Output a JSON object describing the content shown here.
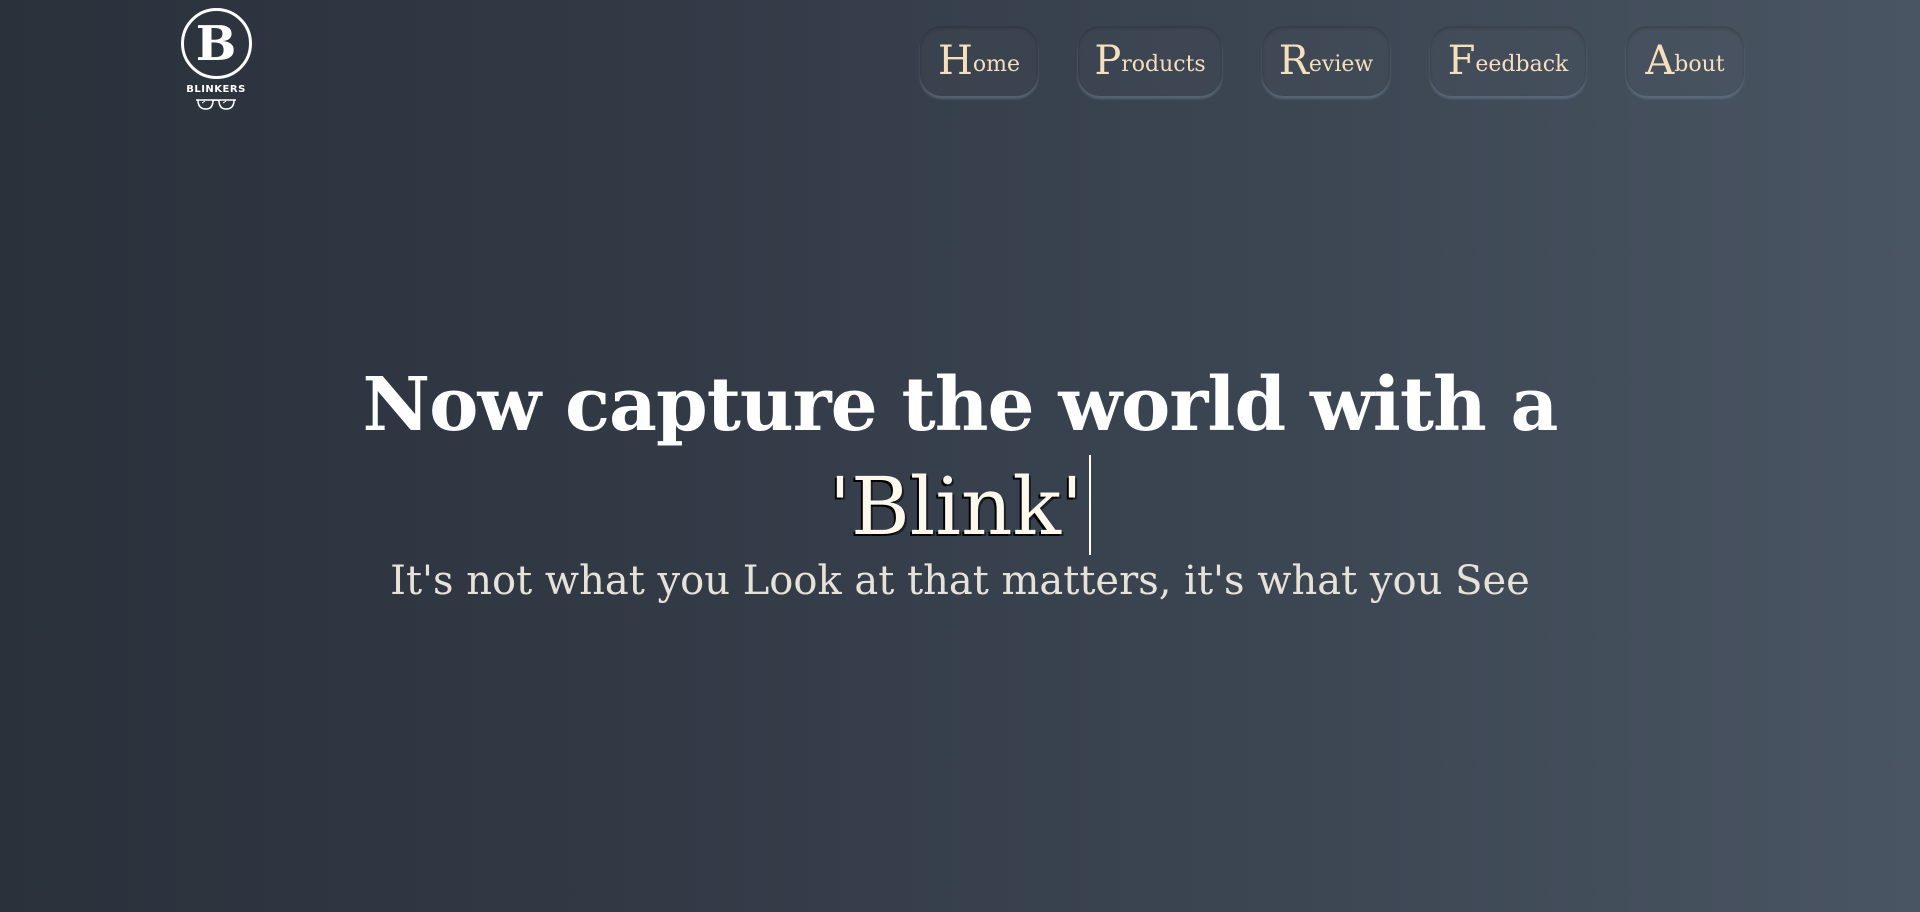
{
  "brand": {
    "logo_letter": "B",
    "name": "BLINKERS",
    "glasses_icon": "glasses-icon"
  },
  "nav": {
    "home": {
      "initial": "H",
      "rest": "ome"
    },
    "products": {
      "initial": "P",
      "rest": "roducts"
    },
    "review": {
      "initial": "R",
      "rest": "eview"
    },
    "feedback": {
      "initial": "F",
      "rest": "eedback"
    },
    "about": {
      "initial": "A",
      "rest": "bout"
    }
  },
  "hero": {
    "headline": "Now capture the world with a",
    "typed_word": "'Blink'",
    "tagline": "It's not what you Look at that matters, it's what you See"
  },
  "colors": {
    "nav_text": "#f5dfbd",
    "headline": "#ffffff",
    "tagline": "#e7e2d8",
    "background_start": "#2a313b",
    "background_end": "#4a5563"
  }
}
